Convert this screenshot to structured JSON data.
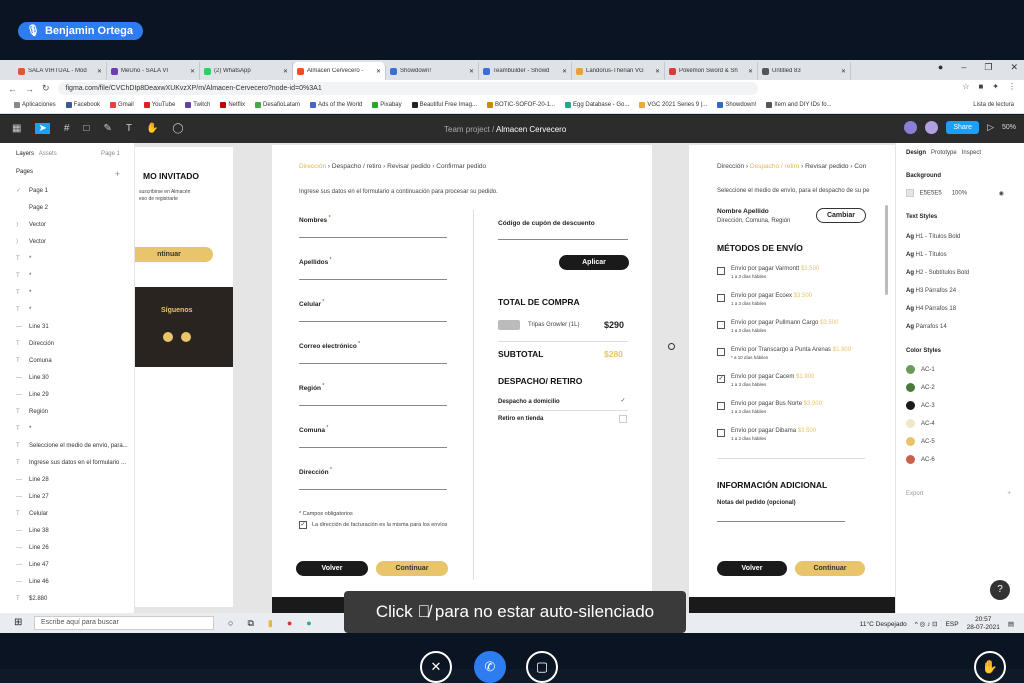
{
  "meet": {
    "user_name": "Benjamin Ortega",
    "toast": "Click ",
    "toast_rest": " para no estar auto-silenciado"
  },
  "tabs": [
    {
      "label": "SALA VIRTUAL - Mód",
      "color": "#e0572a"
    },
    {
      "label": "MeUno - SALA VI",
      "color": "#6a3fb5"
    },
    {
      "label": "(2) WhatsApp",
      "color": "#25d366"
    },
    {
      "label": "Almacen Cervecero - ",
      "color": "#f24e1e",
      "active": true
    },
    {
      "label": "Showdown!",
      "color": "#3a6ed8"
    },
    {
      "label": "Teambuilder - Showd",
      "color": "#3a6ed8"
    },
    {
      "label": "Landorus-Therian VG",
      "color": "#e8a13a"
    },
    {
      "label": "Pokémon Sword & Sh",
      "color": "#d93a3a"
    },
    {
      "label": "Untitled 83",
      "color": "#555555"
    }
  ],
  "browser": {
    "url": "figma.com/file/CVChDIp8DeaxwXUKvzXP/m/Almacen-Cervecero?node-id=0%3A1",
    "bookmarks": [
      "Aplicaciones",
      "Facebook",
      "Gmail",
      "YouTube",
      "Twitch",
      "Netflix",
      "DesafioLatam",
      "Ads of the World",
      "Pixabay",
      "Beautiful Free Imag...",
      "BOTIC-SOFOF-20-1...",
      "Egg Database - Go...",
      "VGC 2021 Series 9 |...",
      "Showdown!",
      "Item and DIY IDs fo..."
    ],
    "reading_list": "Lista de lectura"
  },
  "figma": {
    "project": "Team project /",
    "file": "Almacen Cervecero",
    "share": "Share",
    "zoom": "50%"
  },
  "layers": {
    "tab_layers": "Layers",
    "tab_assets": "Assets",
    "page_sel": "Page 1",
    "pages_title": "Pages",
    "pages": [
      "Page 1",
      "Page 2"
    ],
    "items": [
      "Vector",
      "Vector",
      "*",
      "*",
      "*",
      "*",
      "Line 31",
      "Dirección",
      "Comuna",
      "Line 30",
      "Line 29",
      "Región",
      "*",
      "Seleccione el medio de envío, para...",
      "Ingrese sus datos en el formulario ...",
      "Line 28",
      "Line 27",
      "Celular",
      "Line 38",
      "Line 26",
      "Line 47",
      "Line 46",
      "$2.880"
    ]
  },
  "frame1": {
    "title": "MO INVITADO",
    "t1": "suscribirse en Almacén",
    "t2": "eso de registrarte",
    "continue": "ntinuar",
    "follow": "Síguenos"
  },
  "frame2": {
    "bc1": "Dirección",
    "bc2": "Despacho / retiro",
    "bc3": "Revisar pedido",
    "bc4": "Confirmar pedido",
    "intro": "Ingrese sus datos en el formulario a continuación para procesar su pedido.",
    "fields": [
      "Nombres",
      "Apellidos",
      "Celular",
      "Correo electrónico",
      "Región",
      "Comuna",
      "Dirección"
    ],
    "coupon": "Código de cupón de descuento",
    "apply": "Aplicar",
    "total_title": "TOTAL DE COMPRA",
    "product": "Tripas Growler (1L)",
    "price": "$290",
    "subtotal": "SUBTOTAL",
    "subtotal_val": "$280",
    "delivery_title": "DESPACHO/ RETIRO",
    "opt1": "Despacho a domicilio",
    "opt2": "Retiro en tienda",
    "required": "* Campos obligatorios",
    "billing": "La dirección de facturación es la misma para los envíos",
    "back": "Volver",
    "continue": "Continuar"
  },
  "frame3": {
    "bc1": "Dirección",
    "bc2": "Despacho / retiro",
    "bc3": "Revisar pedido",
    "bc4": "Con",
    "intro": "Seleccione el medio de envío, para el despacho de su pe",
    "name": "Nombre Apellido",
    "addr": "Dirección, Comuna, Región",
    "change": "Cambiar",
    "methods_title": "MÉTODOS DE ENVÍO",
    "methods": [
      {
        "label": "Envío por pagar Varmontt",
        "price": "$3.500",
        "days": "1 a 3 días hábiles",
        "checked": false
      },
      {
        "label": "Envío por pagar Ecoex",
        "price": "$3.500",
        "days": "1 a 3 días hábiles",
        "checked": false
      },
      {
        "label": "Envío por pagar Pullmann Cargo",
        "price": "$3.500",
        "days": "1 a 3 días hábiles",
        "checked": false
      },
      {
        "label": "Envío por Transcargo a Punta Arenas",
        "price": "$1.900",
        "days": "* a 10 días hábiles",
        "checked": false
      },
      {
        "label": "Envío por pagar Cacem",
        "price": "$1.900",
        "days": "1 a 3 días hábiles",
        "checked": true
      },
      {
        "label": "Envío por pagar Bus Norte",
        "price": "$3.900",
        "days": "1 a 3 días hábiles",
        "checked": false
      },
      {
        "label": "Envío por pagar Dibama",
        "price": "$3.500",
        "days": "1 a 2 días hábiles",
        "checked": false
      }
    ],
    "extra_title": "INFORMACIÓN ADICIONAL",
    "notes": "Notas del pedido (opcional)",
    "back": "Volver",
    "continue": "Continuar"
  },
  "design": {
    "tab_design": "Design",
    "tab_prototype": "Prototype",
    "tab_inspect": "Inspect",
    "bg_title": "Background",
    "bg_hex": "E5E5E5",
    "bg_pct": "100%",
    "text_title": "Text Styles",
    "text_styles": [
      "H1 - Títulos Bold",
      "H1 - Títulos",
      "H2 - Subtítulos Bold",
      "H3 Párrafos 24",
      "H4 Párrafos 18",
      "Párrafos 14"
    ],
    "color_title": "Color Styles",
    "colors": [
      {
        "name": "AC-1",
        "hex": "#6a9a5a"
      },
      {
        "name": "AC-2",
        "hex": "#4a7a3a"
      },
      {
        "name": "AC-3",
        "hex": "#1a1a1a"
      },
      {
        "name": "AC-4",
        "hex": "#f0e6c8"
      },
      {
        "name": "AC-5",
        "hex": "#e8c46a"
      },
      {
        "name": "AC-6",
        "hex": "#c8604a"
      }
    ],
    "export": "Export"
  },
  "taskbar": {
    "search": "Escribe aquí para buscar",
    "weather": "11°C Despejado",
    "lang": "ESP",
    "time": "20:57",
    "date": "28-07-2021"
  }
}
